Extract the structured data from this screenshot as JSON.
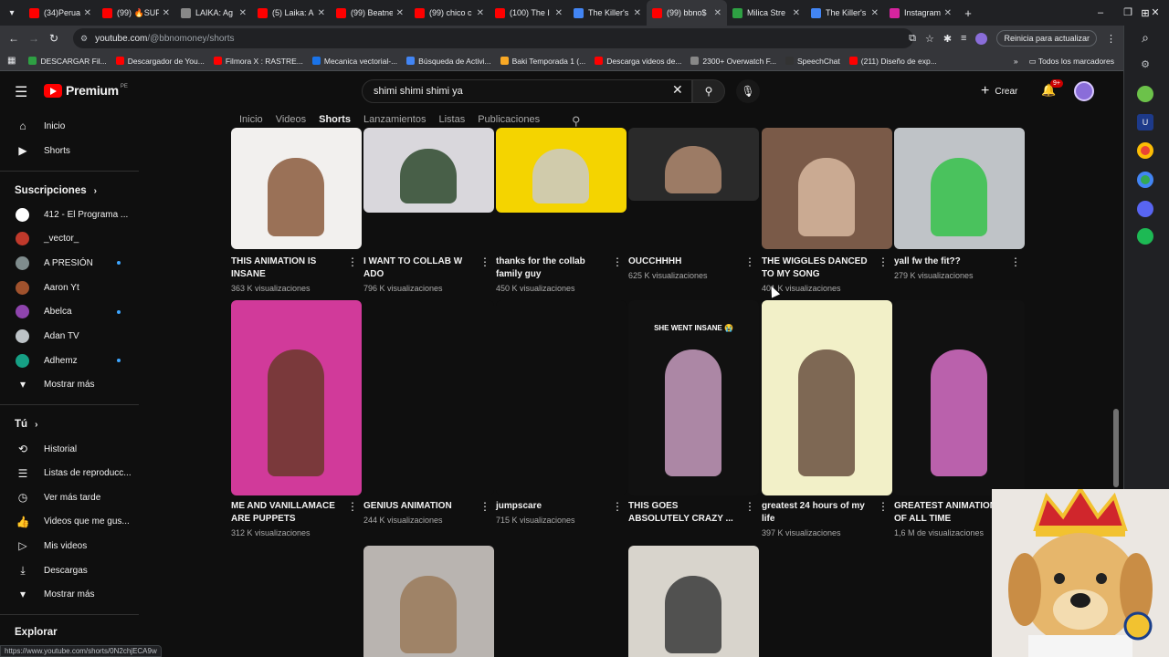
{
  "browser": {
    "tabs": [
      {
        "title": "(34)Peruan",
        "color": "#ff0000"
      },
      {
        "title": "(99) 🔥SUP",
        "color": "#ff0000"
      },
      {
        "title": "LAIKA: Ag",
        "color": "#888888"
      },
      {
        "title": "(5) Laika: A",
        "color": "#ff0000"
      },
      {
        "title": "(99) Beatne",
        "color": "#ff0000"
      },
      {
        "title": "(99) chico c",
        "color": "#ff0000"
      },
      {
        "title": "(100) The I",
        "color": "#ff0000"
      },
      {
        "title": "The Killer's",
        "color": "#4285f4"
      },
      {
        "title": "(99) bbno$",
        "color": "#ff0000"
      },
      {
        "title": "Milica Stre",
        "color": "#2ea043"
      },
      {
        "title": "The Killer's",
        "color": "#4285f4"
      },
      {
        "title": "Instagram",
        "color": "#d6249f"
      }
    ],
    "active_tab_index": 8,
    "url_host": "youtube.com",
    "url_path": "/@bbnomoney/shorts",
    "update_label": "Reinicia para actualizar",
    "new_tab": "+",
    "bookmarks": [
      {
        "label": "DESCARGAR Fil...",
        "color": "#2ea043"
      },
      {
        "label": "Descargador de You...",
        "color": "#ff0000"
      },
      {
        "label": "Filmora X : RASTRE...",
        "color": "#ff0000"
      },
      {
        "label": "Mecanica vectorial-...",
        "color": "#1a73e8"
      },
      {
        "label": "Búsqueda de Activi...",
        "color": "#4285f4"
      },
      {
        "label": "Baki Temporada 1 (...",
        "color": "#f9a825"
      },
      {
        "label": "Descarga videos de...",
        "color": "#ff0000"
      },
      {
        "label": "2300+ Overwatch F...",
        "color": "#888888"
      },
      {
        "label": "SpeechChat",
        "color": "#333333"
      },
      {
        "label": "(211) Diseño de exp...",
        "color": "#ff0000"
      }
    ],
    "bookmarks_more": "»",
    "all_bookmarks": "Todos los marcadores",
    "status_url": "https://www.youtube.com/shorts/0N2chjECA9w"
  },
  "youtube": {
    "logo_text": "Premium",
    "country_code": "PE",
    "search_query": "shimi shimi shimi ya",
    "create_label": "Crear",
    "notif_count": "9+",
    "channel_tabs": [
      "Inicio",
      "Videos",
      "Shorts",
      "Lanzamientos",
      "Listas",
      "Publicaciones"
    ],
    "active_channel_tab": "Shorts"
  },
  "sidebar": {
    "main": [
      {
        "label": "Inicio",
        "icon": "home-icon"
      },
      {
        "label": "Shorts",
        "icon": "shorts-icon"
      }
    ],
    "subs_header": "Suscripciones",
    "subscriptions": [
      {
        "label": "412 - El Programa ...",
        "color": "#ffffff",
        "dot": false
      },
      {
        "label": "_vector_",
        "color": "#c0392b",
        "dot": false
      },
      {
        "label": "A PRESIÓN",
        "color": "#7f8c8d",
        "dot": true
      },
      {
        "label": "Aaron Yt",
        "color": "#a0522d",
        "dot": false
      },
      {
        "label": "Abelca",
        "color": "#8e44ad",
        "dot": true
      },
      {
        "label": "Adan TV",
        "color": "#bdc3c7",
        "dot": false
      },
      {
        "label": "Adhemz",
        "color": "#16a085",
        "dot": true
      }
    ],
    "show_more": "Mostrar más",
    "you_header": "Tú",
    "you_items": [
      {
        "label": "Historial",
        "icon": "history-icon"
      },
      {
        "label": "Listas de reproducc...",
        "icon": "playlists-icon"
      },
      {
        "label": "Ver más tarde",
        "icon": "watch-later-icon"
      },
      {
        "label": "Videos que me gus...",
        "icon": "like-icon"
      },
      {
        "label": "Mis videos",
        "icon": "my-videos-icon"
      },
      {
        "label": "Descargas",
        "icon": "downloads-icon"
      }
    ],
    "show_more_2": "Mostrar más",
    "explore_header": "Explorar"
  },
  "shorts": [
    {
      "title": "THIS ANIMATION IS INSANE",
      "views": "363 K visualizaciones",
      "bg": "#f2f0ee",
      "accent": "#8b5a3c"
    },
    {
      "title": "I WANT TO COLLAB W ADO",
      "views": "796 K visualizaciones",
      "bg": "#d9d7dc",
      "accent": "#2e4a2e"
    },
    {
      "title": "thanks for the collab family guy",
      "views": "450 K visualizaciones",
      "bg": "#f4d400",
      "accent": "#c9c9c9"
    },
    {
      "title": "OUCCHHHH",
      "views": "625 K visualizaciones",
      "bg": "#2a2a2a",
      "accent": "#b08a70"
    },
    {
      "title": "THE WIGGLES DANCED TO MY SONG",
      "views": "401 K visualizaciones",
      "bg": "#7a5a48",
      "accent": "#d8b8a0"
    },
    {
      "title": "yall fw the fit??",
      "views": "279 K visualizaciones",
      "bg": "#bfc3c7",
      "accent": "#35c24a"
    },
    {
      "title": "ME AND VANILLAMACE ARE PUPPETS",
      "views": "312 K visualizaciones",
      "bg": "#d13a9a",
      "accent": "#6b3a2a"
    },
    {
      "title": "GENIUS ANIMATION",
      "views": "244 K visualizaciones",
      "bg": "#0f0f0f",
      "accent": "#0f0f0f"
    },
    {
      "title": "jumpscare",
      "views": "715 K visualizaciones",
      "bg": "#0f0f0f",
      "accent": "#0f0f0f"
    },
    {
      "title": "THIS GOES ABSOLUTELY CRAZY ...",
      "views": "",
      "bg": "#111111",
      "accent": "#c89cbf",
      "caption": "SHE WENT INSANE 😭"
    },
    {
      "title": "greatest 24 hours of my life",
      "views": "397 K visualizaciones",
      "bg": "#f2f0c8",
      "accent": "#6a5040"
    },
    {
      "title": "GREATEST ANIMATION OF ALL TIME",
      "views": "1,6 M de visualizaciones",
      "bg": "#111111",
      "accent": "#d870c8"
    },
    {
      "title": "",
      "views": "",
      "bg": "#b9b4b0",
      "accent": "#9a7a5a"
    },
    {
      "title": "",
      "views": "",
      "bg": "#d8d4cc",
      "accent": "#3a3a3a"
    }
  ]
}
